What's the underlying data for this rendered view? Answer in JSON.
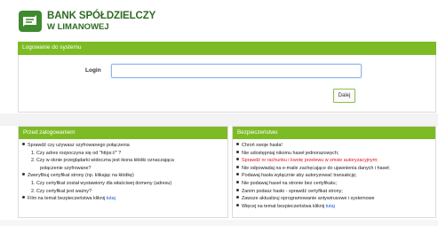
{
  "brand": {
    "line1": "BANK SPÓŁDZIELCZY",
    "line2": "W LIMANOWEJ"
  },
  "login": {
    "title": "Logowanie do systemu",
    "label": "Login",
    "value": "",
    "submit": "Dalej"
  },
  "before_login": {
    "title": "Przed zalogowaniem",
    "items": [
      {
        "text": "Sprawdź czy używasz szyfrowanego połączenia",
        "level": 0
      },
      {
        "text": "1. Czy adres rozpoczyna się od \"https://\" ?",
        "level": 1
      },
      {
        "text": "2. Czy w oknie przeglądarki widoczna jest ikona kłódki oznaczająca",
        "level": 1
      },
      {
        "text": "połączenie szyfrowane?",
        "level": 2
      },
      {
        "text": "Zweryfikuj certyfikat strony (np. klikając na kłódkę)",
        "level": 0
      },
      {
        "text": "1. Czy certyfikat został wystawiony dla właściwej domeny (adresu)",
        "level": 1
      },
      {
        "text": "2. Czy certyfikat jest ważny?",
        "level": 1
      },
      {
        "text": "Film na temat bezpieczeństwa kliknij",
        "level": 0,
        "link": "tutaj"
      }
    ]
  },
  "security": {
    "title": "Bezpieczeństwo",
    "items": [
      {
        "text": "Chroń swoje hasła!"
      },
      {
        "text": "Nie udostępniaj nikomu haseł jednorazowych;"
      },
      {
        "text": "Sprawdź nr rachunku i kwotę przelewu w smsie autoryzacyjnym;",
        "red": true
      },
      {
        "text": "Nie odpowiadaj na e-maile zachęcające do ujawnienia danych i haseł;"
      },
      {
        "text": "Podawaj hasła wyłącznie aby autoryzować transakcję;"
      },
      {
        "text": "Nie podawaj haseł na stronie bez certyfikatu;"
      },
      {
        "text": "Zanim podasz hasło - sprawdź certyfikat strony;"
      },
      {
        "text": "Zawsze aktualizuj oprogramowanie antywirusowe i systemowe"
      },
      {
        "text": "Więcej na temat bezpieczeństwa kliknij",
        "link": "tutaj"
      }
    ]
  },
  "colors": {
    "brand_green": "#2f6a24",
    "header_green": "#7dbb24",
    "warning_red": "#e0101a",
    "link_blue": "#1a56c8"
  },
  "icons": {
    "logo": "bank-logo-icon",
    "bullet": "bullet-icon"
  }
}
